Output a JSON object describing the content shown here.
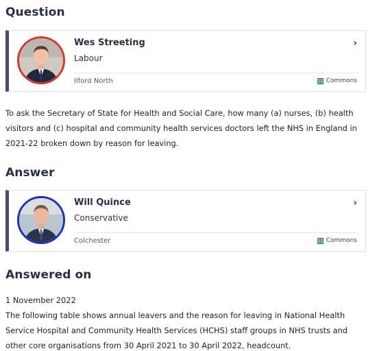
{
  "question": {
    "heading": "Question",
    "member": {
      "name": "Wes Streeting",
      "party": "Labour",
      "constituency": "Ilford North",
      "house": "Commons",
      "party_color": "#d4382c"
    },
    "text": "To ask the Secretary of State for Health and Social Care, how many (a) nurses, (b) health visitors and (c) hospital and community health services doctors left the NHS in England in 2021-22 broken down by reason for leaving."
  },
  "answer": {
    "heading": "Answer",
    "member": {
      "name": "Will Quince",
      "party": "Conservative",
      "constituency": "Colchester",
      "house": "Commons",
      "party_color": "#1e2fb8"
    }
  },
  "answered_on": {
    "heading": "Answered on",
    "date": "1 November 2022",
    "text": "The following table shows annual leavers and the reason for leaving in National Health Service Hospital and Community Health Services (HCHS) staff groups in NHS trusts and other core organisations from 30 April 2021 to 30 April 2022, headcount."
  },
  "icons": {
    "chevron": "chevron-right-icon",
    "house": "portcullis-icon"
  },
  "colors": {
    "heading": "#273044",
    "card_accent": "#4d4a6f"
  }
}
